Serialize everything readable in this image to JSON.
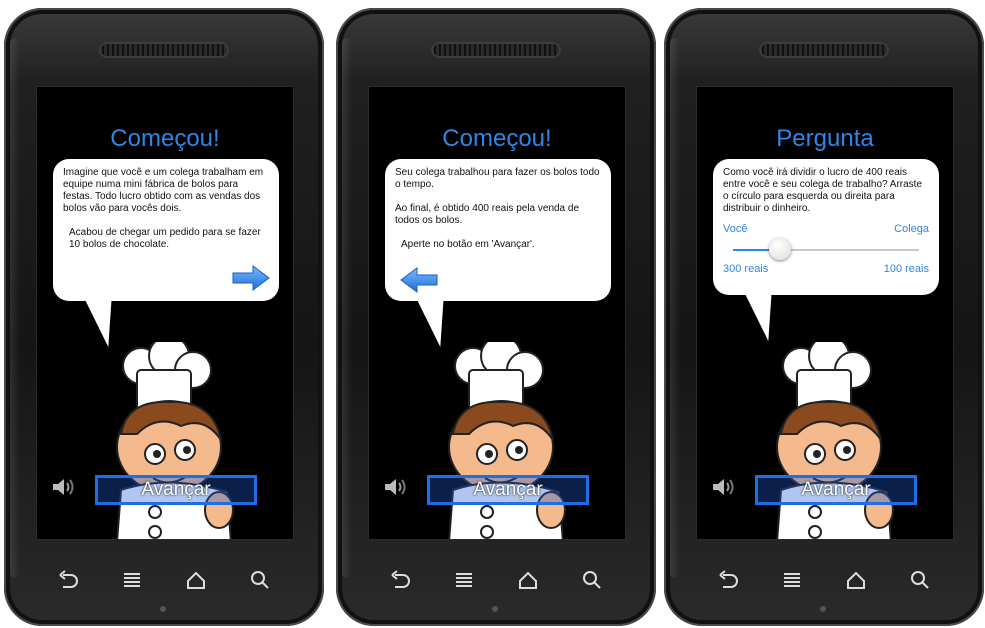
{
  "screens": [
    {
      "title": "Começou!",
      "paragraphs": [
        "Imagine que você e um colega trabalham em equipe numa mini fábrica de bolos para festas. Todo lucro obtido com as vendas dos bolos vão para vocês dois.",
        "Acabou de chegar um pedido para se fazer 10 bolos de chocolate."
      ],
      "arrow": "arrow-right-icon",
      "button_label": "Avançar"
    },
    {
      "title": "Começou!",
      "paragraphs": [
        "Seu colega trabalhou para fazer os bolos todo o tempo.",
        "Ao final, é obtido 400 reais pela venda de todos os bolos.",
        "Aperte no botão em 'Avançar'."
      ],
      "arrow": "arrow-left-icon",
      "button_label": "Avançar"
    },
    {
      "title": "Pergunta",
      "question": "Como você irá dividir o lucro de 400 reais entre você e seu colega de trabalho? Arraste o círculo para esquerda ou direita para distribuir o dinheiro.",
      "slider": {
        "left_label": "Você",
        "right_label": "Colega",
        "left_value": "300 reais",
        "right_value": "100 reais",
        "position_fraction": 0.25
      },
      "button_label": "Avançar"
    }
  ],
  "icons": {
    "speaker": "speaker-icon",
    "back": "back-icon",
    "menu": "menu-icon",
    "home": "home-icon",
    "search": "search-icon"
  },
  "colors": {
    "accent": "#2d86e8",
    "button_border": "#1e6fe6",
    "screen_bg": "#000000",
    "bubble_bg": "#ffffff"
  }
}
